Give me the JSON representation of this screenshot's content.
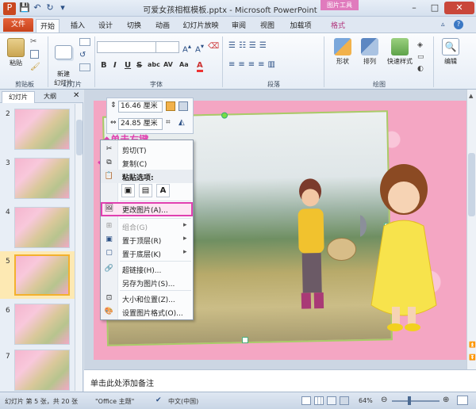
{
  "window": {
    "title": "可爱女孩相框模板.pptx - Microsoft PowerPoint",
    "context_tab_group": "图片工具",
    "minimize": "–",
    "maximize": "□",
    "close": "✕"
  },
  "ribbon_tabs": [
    {
      "label": "文件"
    },
    {
      "label": "开始"
    },
    {
      "label": "插入"
    },
    {
      "label": "设计"
    },
    {
      "label": "切换"
    },
    {
      "label": "动画"
    },
    {
      "label": "幻灯片放映"
    },
    {
      "label": "审阅"
    },
    {
      "label": "视图"
    },
    {
      "label": "加载项"
    },
    {
      "label": "格式"
    }
  ],
  "ribbon": {
    "clipboard": {
      "paste": "粘贴",
      "group": "剪贴板"
    },
    "slides": {
      "new_slide": "新建\n幻灯片",
      "group": "幻灯片"
    },
    "font": {
      "group": "字体",
      "bold": "B",
      "italic": "I",
      "underline": "U",
      "strike": "S",
      "shadow": "abc",
      "spacing": "AV",
      "case": "Aa",
      "color": "A"
    },
    "paragraph": {
      "group": "段落"
    },
    "drawing": {
      "shape": "形状",
      "arrange": "排列",
      "quick_style": "快速样式",
      "group": "绘图"
    },
    "editing": {
      "label": "编辑"
    }
  },
  "left_pane": {
    "tab_slides": "幻灯片",
    "tab_outline": "大纲",
    "slide_numbers": [
      "2",
      "3",
      "4",
      "5",
      "6",
      "7"
    ],
    "selected_index": 3
  },
  "format_mini": {
    "height": "16.46 厘米",
    "width": "24.85 厘米"
  },
  "annotation": {
    "right_click": "◆单击右键"
  },
  "context_menu": {
    "cut": "剪切(T)",
    "copy": "复制(C)",
    "paste_options": "粘贴选项:",
    "change_picture": "更改图片(A)...",
    "group": "组合(G)",
    "bring_to_front": "置于顶层(R)",
    "send_to_back": "置于底层(K)",
    "hyperlink": "超链接(H)...",
    "save_as_picture": "另存为图片(S)...",
    "size_position": "大小和位置(Z)...",
    "format_picture": "设置图片格式(O)..."
  },
  "notes_placeholder": "单击此处添加备注",
  "status": {
    "slide": "幻灯片 第 5 张，共 20 张",
    "theme": "\"Office 主题\"",
    "language": "中文(中国)",
    "zoom": "64%"
  }
}
